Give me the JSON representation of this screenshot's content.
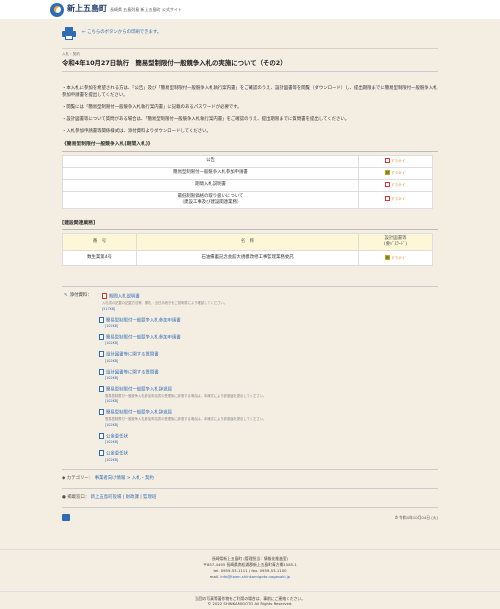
{
  "header": {
    "site_name": "新上五島町",
    "site_sub": "長崎県 五島列島 新上五島町 公式サイト"
  },
  "print_note": "← こちらのボタンからの印刷できます。",
  "category": "入札・契約",
  "title": "令和4年10月27日執行　簡易型制限付一般競争入札の実施について（その2）",
  "paragraphs": [
    "・本入札に参加を希望される方は、「公告」及び「簡易型制限付一般競争入札執行案内書」をご確認のうえ、設計図書等を閲覧（ダウンロード）し、提出期限までに簡易型制限付一般競争入札参加申請書を提出してください。",
    "・閲覧には「簡易型制限付一般競争入札執行案内書」に記載のあるパスワードが必要です。",
    "・設計図書等について質問がある場合は、「簡易型制限付一般競争入札執行案内書」をご確認のうえ、提出期限までに質問書を提出してください。",
    "・入札参加申請書等関係様式は、添付資料よりダウンロードしてください。"
  ],
  "section1": {
    "heading": "《簡易型制限付一般競争入札(期間入札)》",
    "rows": [
      {
        "label": "公告",
        "icon": "pdf-icon",
        "dl": "ﾀﾞｳﾝﾛｰﾄﾞ"
      },
      {
        "label": "簡易型制限付一般競争入札参加申請書",
        "icon": "document-icon",
        "dl": "ﾀﾞｳﾝﾛｰﾄﾞ"
      },
      {
        "label": "期間入札説明書",
        "icon": "pdf-icon",
        "dl": "ﾀﾞｳﾝﾛｰﾄﾞ"
      },
      {
        "label1": "最低制限価格の取り扱いについて",
        "label2": "（建設工事及び建設関連業務）",
        "icon": "pdf-icon",
        "dl": "ﾀﾞｳﾝﾛｰﾄﾞ"
      }
    ]
  },
  "section2": {
    "heading": "[建設関連業務]",
    "headers": [
      "番　号",
      "名　称",
      "設計図書等",
      "(要ﾊﾟｽﾜｰﾄﾞ)"
    ],
    "row": {
      "num": "数生業第4号",
      "name": "石油備蓄記念会館大規模改修工事監理業務委託",
      "dl": "ﾀﾞｳﾝﾛｰﾄﾞ"
    }
  },
  "attachments": {
    "label": "添付資料：",
    "items": [
      {
        "title": "期間入札説明書",
        "note": "入札書の記載の記載方法等、開札・当日手続きをご説明書により確認してください。",
        "size": "[517KB]",
        "type": "pdf"
      },
      {
        "title": "簡易型制限付一般競争入札参加申請書",
        "size": "[102KB]",
        "type": "doc"
      },
      {
        "title": "簡易型制限付一般競争入札参加申請書",
        "size": "[102KB]",
        "type": "doc"
      },
      {
        "title": "設計図書等に関する質問書",
        "size": "[102KB]",
        "type": "doc"
      },
      {
        "title": "設計図書等に関する質問書",
        "size": "[102KB]",
        "type": "doc"
      },
      {
        "title": "簡易型制限付一般競争入札辞退届",
        "note": "簡易型制限付一般競争入札参加申請書の受理後に辞退する場合は、本様式により辞退届を提出してください。",
        "size": "[102KB]",
        "type": "doc"
      },
      {
        "title": "簡易型制限付一般競争入札辞退届",
        "note": "簡易型制限付一般競争入札参加申請書の受理後に辞退する場合は、本様式により辞退届を提出してください。",
        "size": "[102KB]",
        "type": "doc"
      },
      {
        "title": "公金委任状",
        "size": "[102KB]",
        "type": "doc"
      },
      {
        "title": "公金委任状",
        "size": "[102KB]",
        "type": "doc"
      }
    ]
  },
  "categories": {
    "label": "カテゴリー：",
    "links": [
      "事業者向け情報",
      "入札・契約"
    ],
    "sep": "> "
  },
  "contact": {
    "label": "掲載窓口：",
    "links": [
      "新上五島町役場",
      "財政課",
      "監理班"
    ]
  },
  "updated": "令和4年10月04日 (火)",
  "footer": {
    "line1": "長崎県新上五島町 (管理担当：情報化推進室)",
    "line2": "〒857-4495 長崎県南松浦郡新上五島町青方郷1585-1",
    "line3": "tel. 0959-53-1111 / fax. 0959-53-1100",
    "mail_label": "mail. ",
    "mail": "info@town.shinkamigoto.nagasaki.jp",
    "copy1": "当団の写真等著作物をご利用の場合は、事前にご連絡ください。",
    "copy2": "© 2022 SHINKAMIGOTO All Rights Reserved."
  }
}
